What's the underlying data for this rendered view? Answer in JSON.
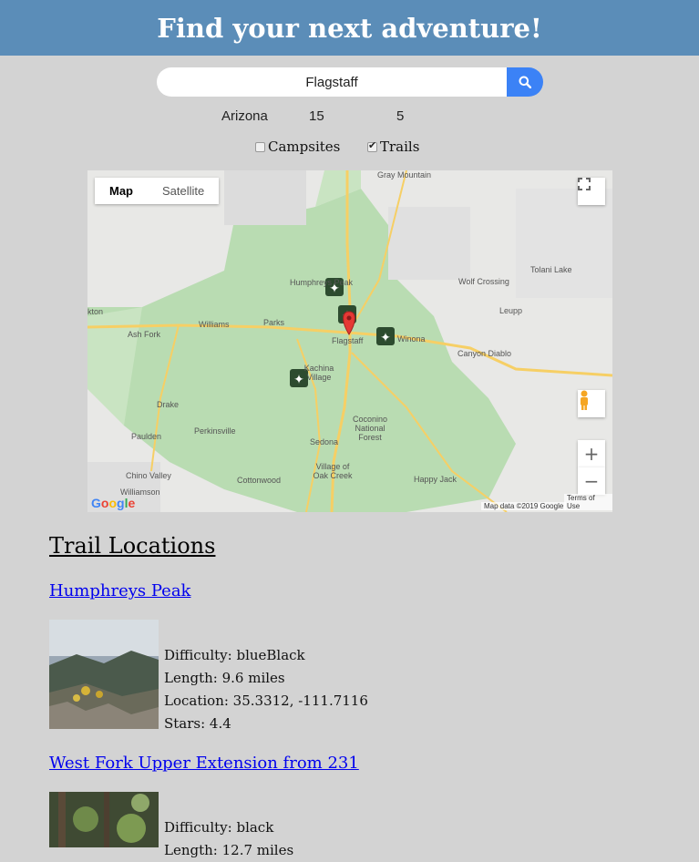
{
  "header": {
    "title": "Find your next adventure!"
  },
  "search": {
    "value": "Flagstaff",
    "placeholder": ""
  },
  "meta": {
    "state": "Arizona",
    "radius": "15",
    "count": "5"
  },
  "filters": [
    {
      "label": "Campsites",
      "checked": false
    },
    {
      "label": "Trails",
      "checked": true
    }
  ],
  "map": {
    "type_buttons": [
      "Map",
      "Satellite"
    ],
    "active_type": "Map",
    "labels": [
      "Williams",
      "Parks",
      "Ash Fork",
      "Flagstaff",
      "Winona",
      "Kachina Village",
      "Canyon Diablo",
      "Leupp",
      "Wolf Crossing",
      "Tolani Lake",
      "Humphreys Peak",
      "Drake",
      "Perkinsville",
      "Paulden",
      "Chino Valley",
      "Williamson",
      "Cottonwood",
      "Sedona",
      "Village of Oak Creek",
      "Coconino National Forest",
      "Happy Jack",
      "Gray Mountain",
      "kton"
    ],
    "attribution": "Map data ©2019 Google",
    "terms": "Terms of Use",
    "logo": "Google",
    "zoom_in": "+",
    "zoom_out": "−"
  },
  "section_title": "Trail Locations",
  "trails": [
    {
      "name": "Humphreys Peak",
      "difficulty": "Difficulty: blueBlack",
      "length": "Length: 9.6 miles",
      "location": "Location: 35.3312, -111.7116",
      "stars": "Stars: 4.4"
    },
    {
      "name": "West Fork Upper Extension from 231",
      "difficulty": "Difficulty: black",
      "length": "Length: 12.7 miles",
      "location": "",
      "stars": ""
    }
  ],
  "colors": {
    "header": "#5b8db8",
    "search_button": "#3b82f6",
    "link": "#0000ee",
    "background": "#d3d3d3"
  }
}
